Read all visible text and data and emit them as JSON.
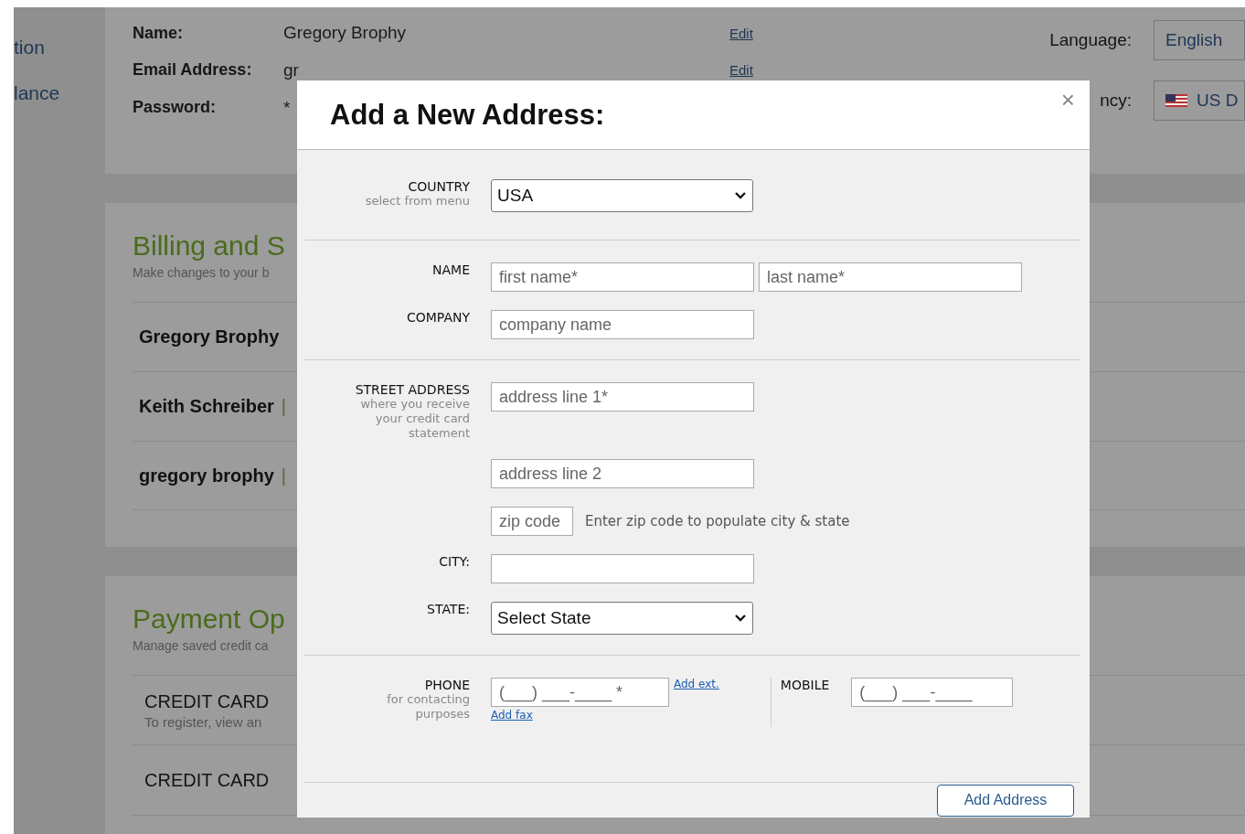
{
  "sidebar": {
    "items": [
      {
        "label": "tion"
      },
      {
        "label": "lance"
      }
    ]
  },
  "account": {
    "fields": [
      {
        "label": "Name:",
        "value": "Gregory Brophy",
        "action": "Edit"
      },
      {
        "label": "Email Address:",
        "value": "gr",
        "action": "Edit"
      },
      {
        "label": "Password:",
        "value": "*"
      }
    ],
    "language": {
      "label": "Language:",
      "value": "English"
    },
    "currency": {
      "label": "ncy:",
      "value": "US D"
    }
  },
  "billing": {
    "title": "Billing and S",
    "subtitle": "Make changes to your b",
    "rows": [
      {
        "name": "Gregory Brophy"
      },
      {
        "name": "Keith Schreiber",
        "separator": "|"
      },
      {
        "name": "gregory brophy",
        "separator": "|"
      }
    ]
  },
  "payment": {
    "title": "Payment Op",
    "subtitle": "Manage saved credit ca",
    "rows": [
      {
        "title": "CREDIT CARD",
        "note": "To register, view an"
      },
      {
        "title": "CREDIT CARD"
      }
    ]
  },
  "dialog": {
    "title": "Add a New Address:",
    "close": "×",
    "sections": [
      {
        "rows": [
          {
            "label": "COUNTRY",
            "hint": "select from menu",
            "controls": [
              {
                "kind": "select",
                "value": "USA"
              }
            ]
          }
        ]
      },
      {
        "rows": [
          {
            "label": "NAME",
            "controls": [
              {
                "kind": "input",
                "placeholder": "first name*"
              },
              {
                "kind": "input",
                "placeholder": "last name*"
              }
            ]
          },
          {
            "label": "COMPANY",
            "controls": [
              {
                "kind": "input",
                "placeholder": "company name"
              }
            ]
          }
        ]
      },
      {
        "rows": [
          {
            "label": "STREET ADDRESS",
            "hint": "where you receive your credit card statement",
            "controls": [
              {
                "kind": "input",
                "placeholder": "address line 1*"
              }
            ]
          },
          {
            "controls": [
              {
                "kind": "input",
                "placeholder": "address line 2"
              }
            ]
          },
          {
            "controls": [
              {
                "kind": "short-input",
                "placeholder": "zip code"
              },
              {
                "kind": "note",
                "text": "Enter zip code to populate city & state"
              }
            ]
          },
          {
            "label": "CITY:",
            "controls": [
              {
                "kind": "input"
              }
            ]
          },
          {
            "label": "STATE:",
            "controls": [
              {
                "kind": "select",
                "value": "Select State"
              }
            ]
          }
        ]
      }
    ],
    "phone": {
      "label": "PHONE",
      "hint": "for contacting purposes",
      "placeholder": "(___) ___-____ *",
      "ext": "Add ext.",
      "fax": "Add fax",
      "mobile_label": "MOBILE",
      "mobile_placeholder": "(___) ___-____"
    },
    "submit": "Add Address"
  }
}
